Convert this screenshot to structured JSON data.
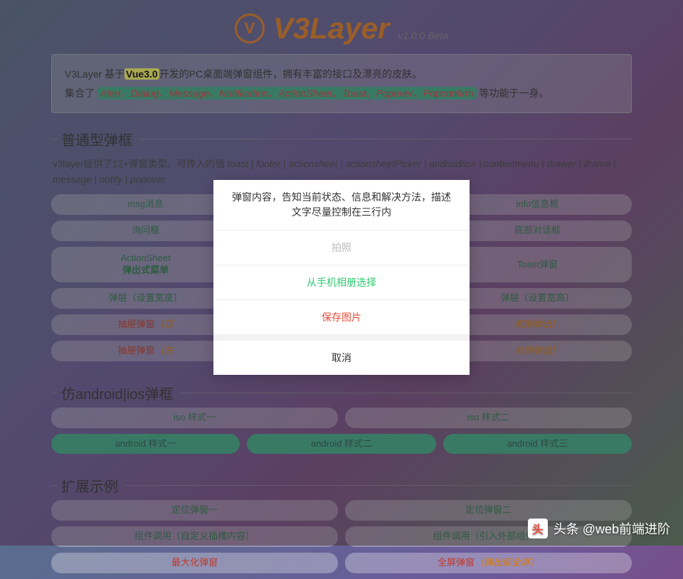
{
  "header": {
    "brand": "V3Layer",
    "version": "v1.0.0 Beta",
    "logo_glyph": "V"
  },
  "intro": {
    "line1_pre": "V3Layer 基于",
    "line1_hl": "Vue3.0",
    "line1_post": "开发的PC桌面端弹窗组件，拥有丰富的接口及漂亮的皮肤。",
    "line2_pre": "集合了 ",
    "line2_hl": "Alert、Dialog、Message、Notification、ActionSheet、Toast、Popover、Popconfirm",
    "line2_post": " 等功能于一身。"
  },
  "sections": {
    "normal": {
      "title": "普通型弹框",
      "subtext_pre": "v3layer提供了12+弹窗类型。可传入的值 ",
      "subtext_types": "toast | footer | actionsheet | actionsheetPicker | android/ios | contextmenu | drawer | iframe | message | notify | popover",
      "rows": [
        [
          "msg消息",
          "",
          "info信息框"
        ],
        [
          "询问框",
          "",
          "底部对话框"
        ],
        [
          "ActionSheet\n弹出式菜单",
          "",
          "Toast弹窗"
        ],
        [
          "弹层（设置宽度）",
          "",
          "弹层（设置宽高）"
        ]
      ],
      "drawer_rows": [
        {
          "label": "抽屉弹窗",
          "note": "（顶",
          "label2": "",
          "note2": "底部弹出）"
        },
        {
          "label": "抽屉弹窗",
          "note": "（左",
          "label2": "",
          "note2": "右侧弹出）"
        }
      ]
    },
    "mobile": {
      "title": "仿android|ios弹框",
      "row1": [
        "iso 样式一",
        "iso 样式二"
      ],
      "row2": [
        "android 样式一",
        "android 样式二",
        "android 样式三"
      ]
    },
    "ext": {
      "title": "扩展示例",
      "row1": [
        "定位弹窗一",
        "定位弹窗二"
      ],
      "row2": [
        "组件调用（自定义插槽内容）",
        "组件调用（引入外部组件）"
      ],
      "row3": [
        {
          "label": "最大化弹窗",
          "note": ""
        },
        {
          "label": "全屏弹窗",
          "note": "（弹出即全屏）"
        }
      ]
    }
  },
  "sheet": {
    "header": "弹窗内容，告知当前状态、信息和解决方法，描述文字尽量控制在三行内",
    "items": [
      {
        "label": "拍照",
        "style": "disabled"
      },
      {
        "label": "从手机相册选择",
        "style": "green"
      },
      {
        "label": "保存图片",
        "style": "red"
      }
    ],
    "cancel": "取消"
  },
  "watermark": {
    "glyph": "头",
    "text": "头条 @web前端进阶"
  }
}
